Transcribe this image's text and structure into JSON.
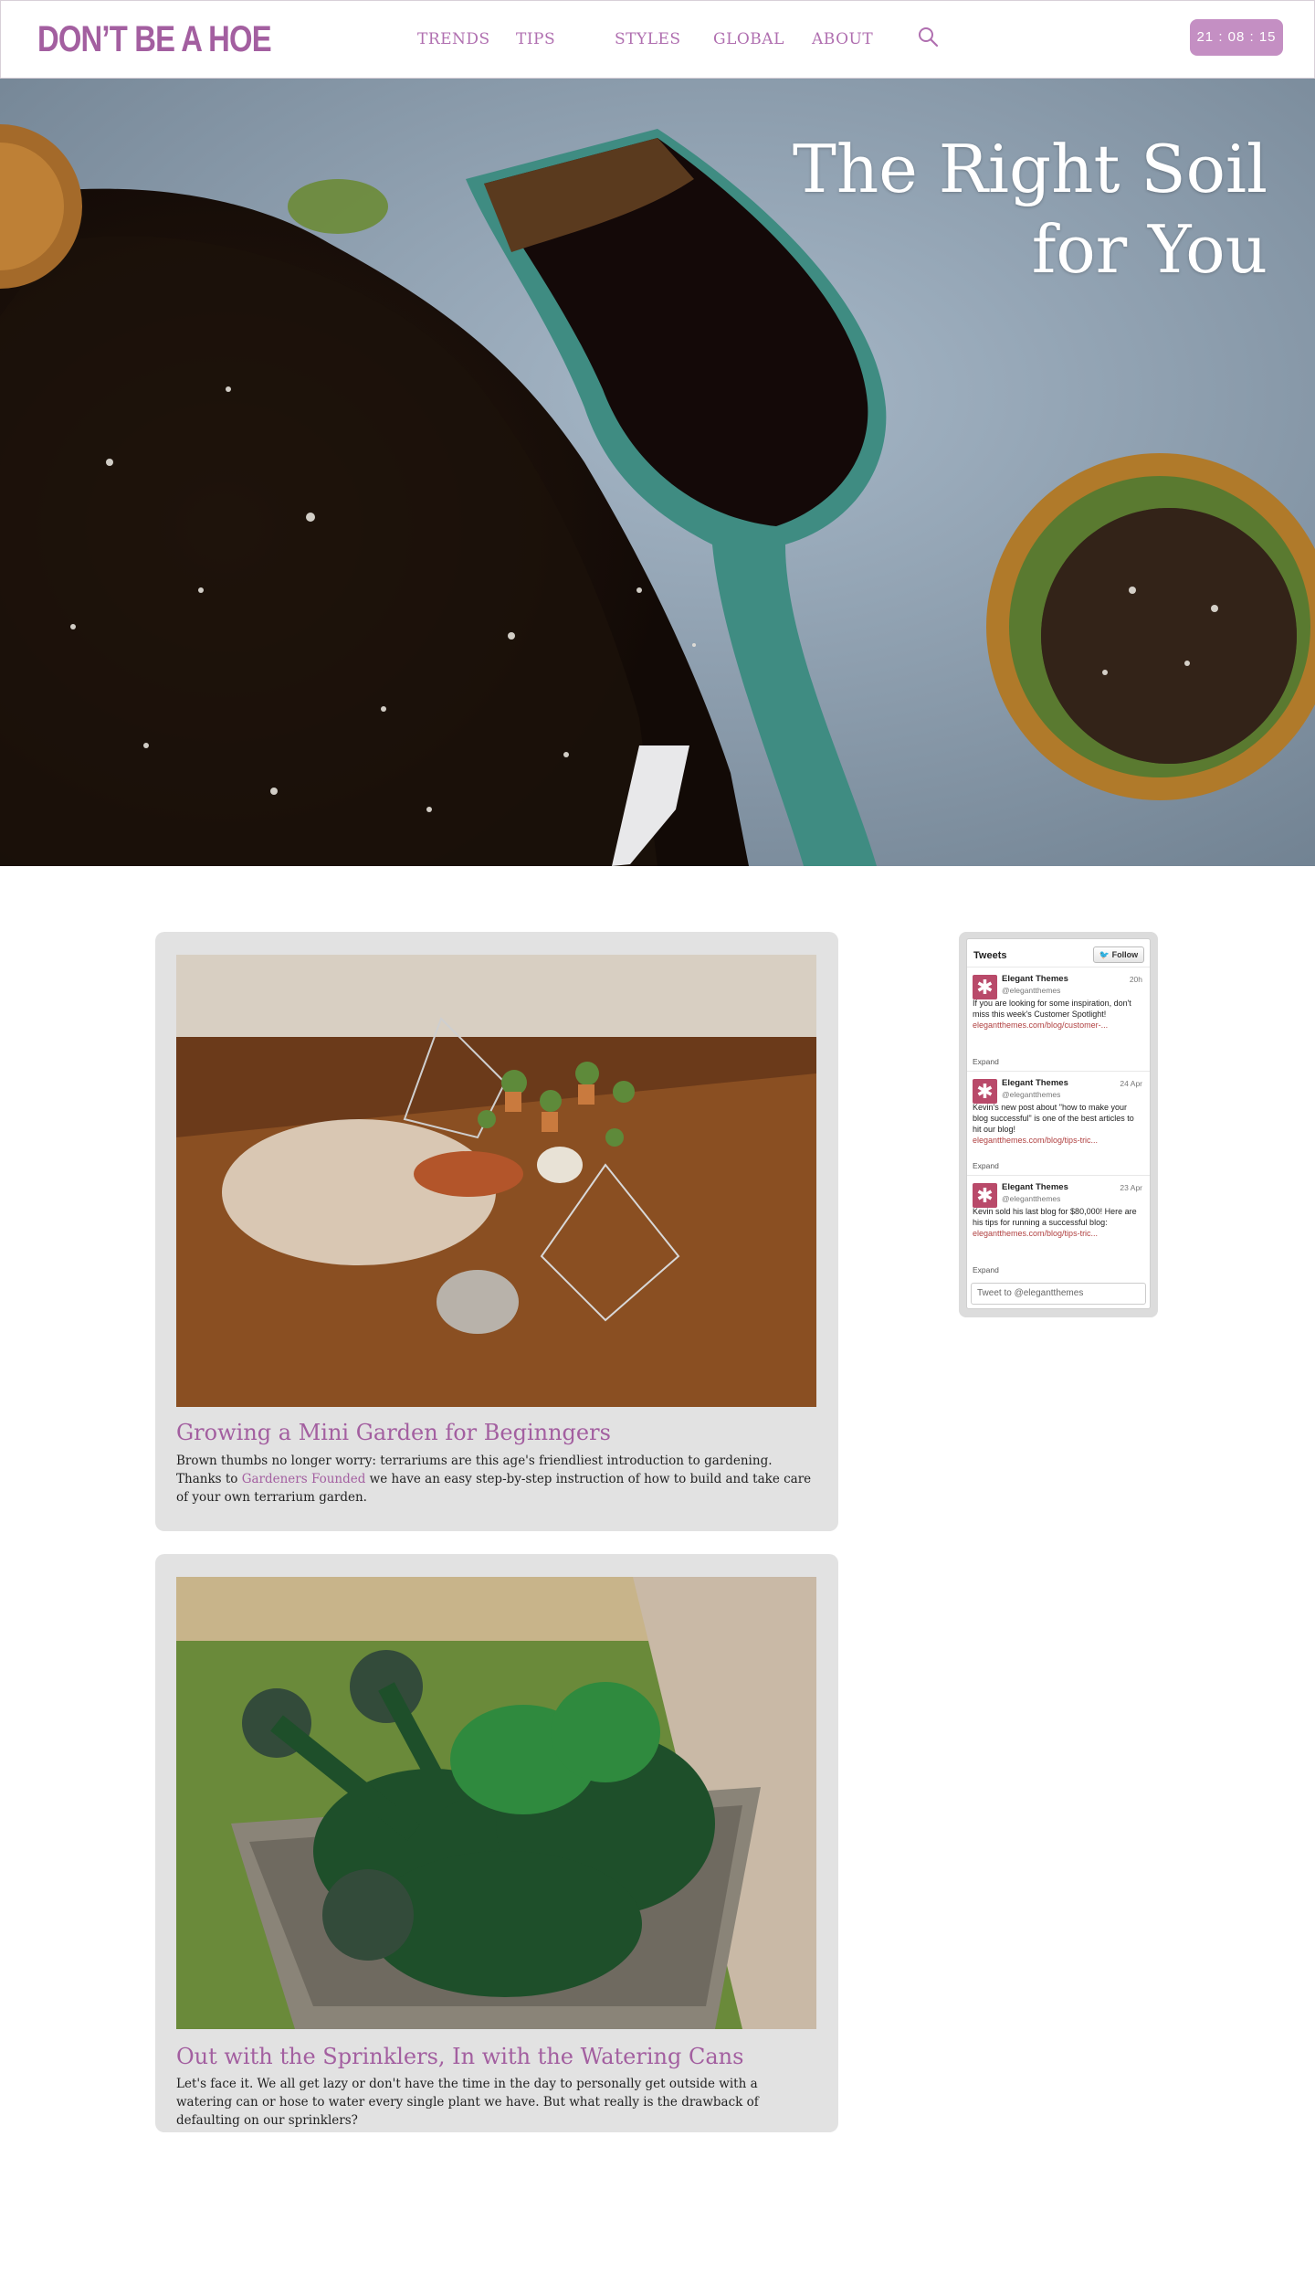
{
  "header": {
    "logo": "DON’T BE A HOE",
    "nav": [
      {
        "label": "TRENDS"
      },
      {
        "label": "TIPS"
      },
      {
        "label": "STYLES"
      },
      {
        "label": "GLOBAL"
      },
      {
        "label": "ABOUT"
      }
    ],
    "search_icon": "search-icon",
    "clock": "21 : 08 : 15"
  },
  "hero": {
    "title": "The Right Soil\nfor You"
  },
  "posts": [
    {
      "title": "Growing a Mini Garden for Beginngers",
      "text_before": "Brown thumbs no longer worry: terrariums are this age's friendliest introduction to gardening. Thanks to ",
      "link": "Gardeners Founded",
      "text_after": " we have an easy step-by-step instruction of how to build and take care of your own terrarium garden."
    },
    {
      "title": "Out with the Sprinklers, In with the Watering Cans",
      "text": "Let's face it. We all get lazy or don't have the time in the day to personally get outside with a watering can or hose to water every single plant we have. But what really is the drawback of defaulting on our sprinklers?"
    }
  ],
  "twitter": {
    "header": "Tweets",
    "follow": "Follow",
    "tweets": [
      {
        "name": "Elegant Themes",
        "handle": "@elegantthemes",
        "time": "20h",
        "text": "If you are looking for some inspiration, don't miss this week's Customer Spotlight!",
        "link": "elegantthemes.com/blog/customer-...",
        "expand": "Expand"
      },
      {
        "name": "Elegant Themes",
        "handle": "@elegantthemes",
        "time": "24 Apr",
        "text": "Kevin's new post about \"how to make your blog successful\" is one of the best articles to hit our blog!",
        "link": "elegantthemes.com/blog/tips-tric...",
        "expand": "Expand"
      },
      {
        "name": "Elegant Themes",
        "handle": "@elegantthemes",
        "time": "23 Apr",
        "text": "Kevin sold his last blog for $80,000! Here are his tips for running a successful blog:",
        "link": "elegantthemes.com/blog/tips-tric...",
        "expand": "Expand"
      }
    ],
    "input_placeholder": "Tweet to @elegantthemes"
  },
  "colors": {
    "brand": "#a35fa0",
    "clock_bg": "#c48fc3",
    "card_bg": "#e2e2e2"
  }
}
